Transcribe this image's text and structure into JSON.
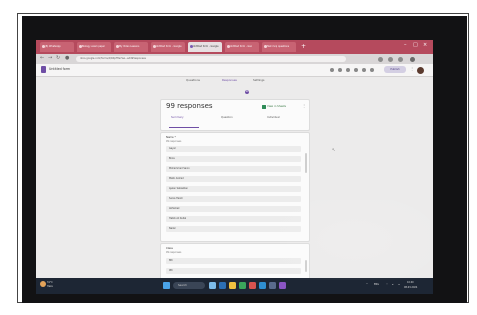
{
  "browser": {
    "tabs": [
      {
        "label": "(8) WhatsApp"
      },
      {
        "label": "Biology exam paper"
      },
      {
        "label": "My Video Lessons"
      },
      {
        "label": "Untitled form - Google"
      },
      {
        "label": "Untitled form - Google",
        "active": true
      },
      {
        "label": "Untitled form - Goo"
      },
      {
        "label": "Test mcq questions"
      }
    ],
    "new_tab_label": "+",
    "url": "docs.google.com/forms/d/1NpT8e7Lw...edit#responses"
  },
  "forms_header": {
    "title": "Untitled form",
    "publish_label": "Publish",
    "more_label": "⋮"
  },
  "main_tabs": {
    "questions": "Questions",
    "responses": "Responses",
    "responses_badge": "99",
    "settings": "Settings"
  },
  "responses_card": {
    "count_text": "99 responses",
    "sheets_link": "View in Sheets",
    "more_label": "⋮",
    "subtabs": {
      "summary": "Summary",
      "question": "Question",
      "individual": "Individual"
    }
  },
  "question1": {
    "title": "Name *",
    "subtitle": "99 responses",
    "answers": [
      {
        "text": "Gayal"
      },
      {
        "text": "Binia"
      },
      {
        "text": "Mohammed Sanin"
      },
      {
        "text": "Malik Arshad"
      },
      {
        "text": "Ajwan Sebastian"
      },
      {
        "text": "Sania Harsh"
      },
      {
        "text": "Abhishek"
      },
      {
        "text": "Habib Ali Kullal"
      },
      {
        "text": "Nailal"
      }
    ]
  },
  "question2": {
    "title": "Class",
    "subtitle": "99 responses",
    "answers": [
      {
        "text": "8th"
      },
      {
        "text": "9th"
      }
    ]
  },
  "taskbar": {
    "weather_temp": "31°C",
    "weather_desc": "Haze",
    "search_label": "Search",
    "tray_lang": "ENG",
    "time": "10:40",
    "date": "08-03-2024"
  },
  "colors": {
    "forms_purple": "#6f4ea5",
    "browser_frame": "#b54a5d",
    "taskbar": "#1d2634"
  }
}
